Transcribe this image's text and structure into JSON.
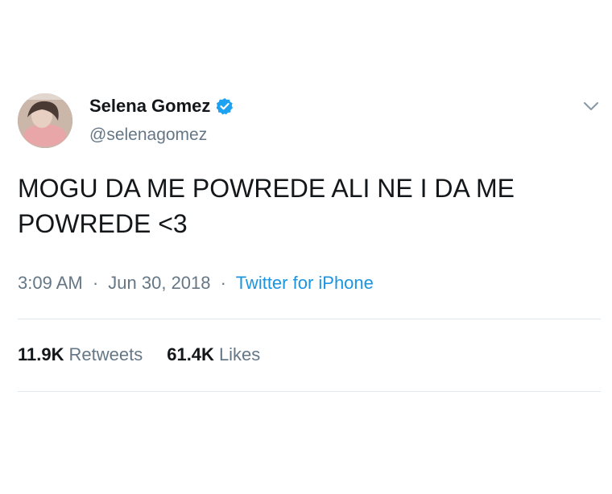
{
  "author": {
    "display_name": "Selena Gomez",
    "handle": "@selenagomez",
    "verified_icon": "verified-badge-icon",
    "avatar": "profile-photo"
  },
  "tweet": {
    "text": "MOGU DA ME POWREDE ALI NE I DA ME\nPOWREDE <3",
    "time": "3:09 AM",
    "date": "Jun 30, 2018",
    "separator": "·",
    "source": "Twitter for iPhone"
  },
  "stats": {
    "retweets_count": "11.9K",
    "retweets_label": "Retweets",
    "likes_count": "61.4K",
    "likes_label": "Likes"
  },
  "colors": {
    "text": "#14171a",
    "secondary": "#657786",
    "link": "#1b95e0",
    "verified": "#1da1f2",
    "divider": "#e1e8ed"
  },
  "menu_icon": "chevron-down-icon"
}
